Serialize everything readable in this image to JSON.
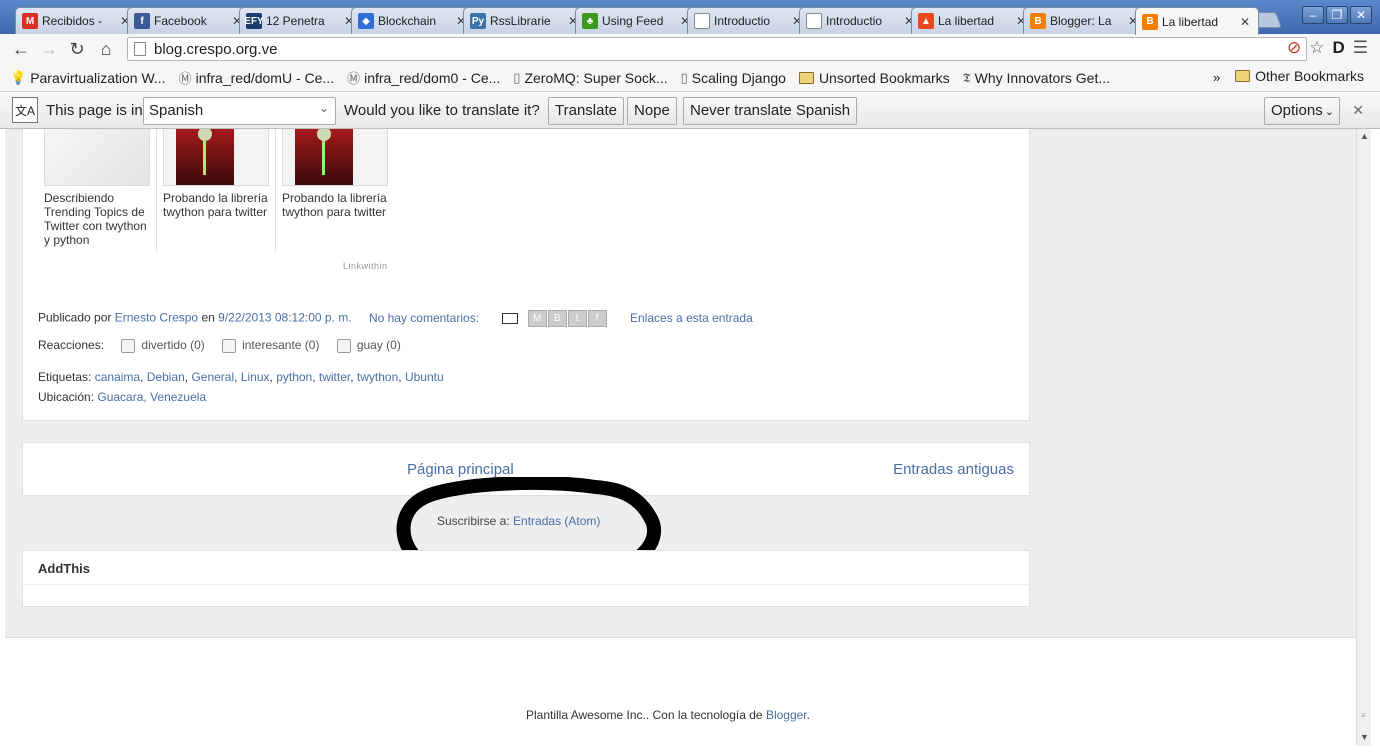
{
  "window": {
    "tabs": [
      {
        "icon": "gmail-icon",
        "title": "Recibidos -",
        "color": "#d93025",
        "glyph": "M"
      },
      {
        "icon": "facebook-icon",
        "title": "Facebook",
        "color": "#3b5998",
        "glyph": "f"
      },
      {
        "icon": "efy-icon",
        "title": "12 Penetra",
        "color": "#1a3c6e",
        "glyph": "EFY"
      },
      {
        "icon": "blockchain-icon",
        "title": "Blockchain",
        "color": "#2f6fd6",
        "glyph": "◆"
      },
      {
        "icon": "python-icon",
        "title": "RssLibrarie",
        "color": "#3b73a8",
        "glyph": "Py"
      },
      {
        "icon": "feed-leaf-icon",
        "title": "Using Feed",
        "color": "#3a9a1e",
        "glyph": "♣"
      },
      {
        "icon": "page-icon",
        "title": "Introductio",
        "color": "#ffffff",
        "glyph": ""
      },
      {
        "icon": "page-icon",
        "title": "Introductio",
        "color": "#ffffff",
        "glyph": ""
      },
      {
        "icon": "fire-icon",
        "title": "La libertad",
        "color": "#e8491d",
        "glyph": "▲"
      },
      {
        "icon": "blogger-icon",
        "title": "Blogger: La",
        "color": "#f57d00",
        "glyph": "B"
      },
      {
        "icon": "blogger-icon",
        "title": "La libertad",
        "color": "#f57d00",
        "glyph": "B"
      }
    ],
    "active_tab_index": 10
  },
  "toolbar": {
    "url": "blog.crespo.org.ve"
  },
  "bookmarks": {
    "items": [
      {
        "icon": "lightbulb-icon",
        "label": "Paravirtualization W..."
      },
      {
        "icon": "medium-m-icon",
        "label": "infra_red/domU - Ce..."
      },
      {
        "icon": "medium-m-icon",
        "label": "infra_red/dom0 - Ce..."
      },
      {
        "icon": "page-icon",
        "label": "ZeroMQ: Super Sock..."
      },
      {
        "icon": "page-icon",
        "label": "Scaling Django"
      },
      {
        "icon": "folder-icon",
        "label": "Unsorted Bookmarks"
      },
      {
        "icon": "nyt-icon",
        "label": "Why Innovators Get..."
      }
    ],
    "overflow": "»",
    "other": "Other Bookmarks"
  },
  "translate_bar": {
    "prefix": "This page is in",
    "language": "Spanish",
    "question": "Would you like to translate it?",
    "translate": "Translate",
    "nope": "Nope",
    "never": "Never translate Spanish",
    "options": "Options"
  },
  "post": {
    "related": [
      {
        "title": "Describiendo Trending Topics de Twitter con twython y python"
      },
      {
        "title": "Probando la librería twython para twitter"
      },
      {
        "title": "Probando la librería twython para twitter"
      }
    ],
    "linkwithin": "Linkwithin",
    "published_prefix": "Publicado por",
    "author": "Ernesto Crespo",
    "on": "en",
    "date": "9/22/2013 08:12:00 p. m.",
    "comments": "No hay comentarios:",
    "links_to_post": "Enlaces a esta entrada",
    "reactions_label": "Reacciones:",
    "reactions": [
      "divertido (0)",
      "interesante (0)",
      "guay (0)"
    ],
    "tags_label": "Etiquetas:",
    "tags": [
      "canaima",
      "Debian",
      "General",
      "Linux",
      "python",
      "twitter",
      "twython",
      "Ubuntu"
    ],
    "location_label": "Ubicación:",
    "location": "Guacara, Venezuela"
  },
  "pager": {
    "home": "Página principal",
    "older": "Entradas antiguas"
  },
  "subscribe": {
    "prefix": "Suscribirse a:",
    "link": "Entradas (Atom)"
  },
  "addthis": {
    "title": "AddThis"
  },
  "footer": {
    "text": "Plantilla Awesome Inc.. Con la tecnología de",
    "link": "Blogger",
    "suffix": "."
  }
}
